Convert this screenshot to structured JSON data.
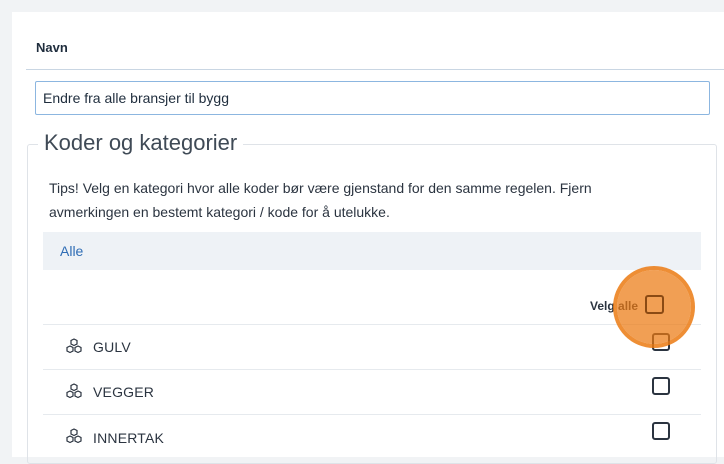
{
  "form": {
    "name_label": "Navn",
    "name_value": "Endre fra alle bransjer til bygg"
  },
  "codes_section": {
    "legend": "Koder og kategorier",
    "tips": "Tips! Velg en kategori hvor alle koder bør være gjenstand for den samme regelen. Fjern avmerkingen en bestemt kategori / kode for å utelukke.",
    "filter_label": "Alle",
    "select_all_label": "Velg alle",
    "categories": [
      {
        "label": "GULV",
        "checked": false,
        "icon": "cubes-icon"
      },
      {
        "label": "VEGGER",
        "checked": false,
        "icon": "cubes-icon"
      },
      {
        "label": "INNERTAK",
        "checked": false,
        "icon": "cubes-icon"
      }
    ]
  },
  "highlight": {
    "color": "#eb7a12",
    "target": "select-all-checkbox"
  }
}
